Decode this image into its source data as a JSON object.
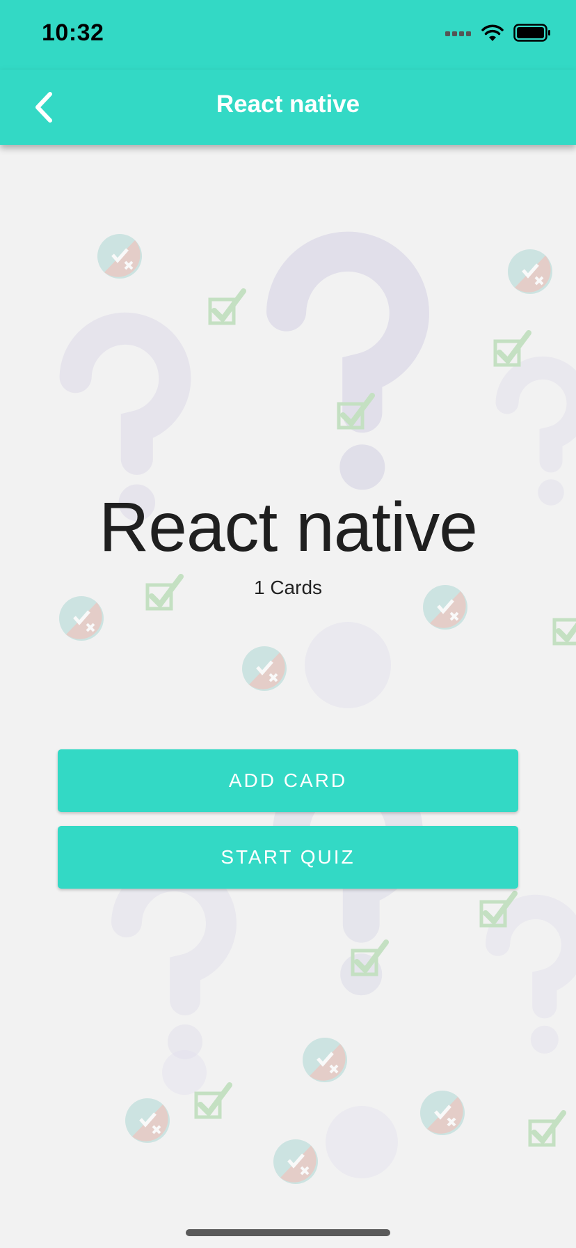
{
  "status_bar": {
    "time": "10:32"
  },
  "header": {
    "title": "React native",
    "back_icon": "chevron-left-icon"
  },
  "deck": {
    "title": "React native",
    "card_count": "1 Cards"
  },
  "actions": {
    "add_card_label": "ADD CARD",
    "start_quiz_label": "START QUIZ"
  },
  "colors": {
    "accent": "#33d9c5",
    "background": "#f2f2f2",
    "text": "#1f1f1f"
  }
}
